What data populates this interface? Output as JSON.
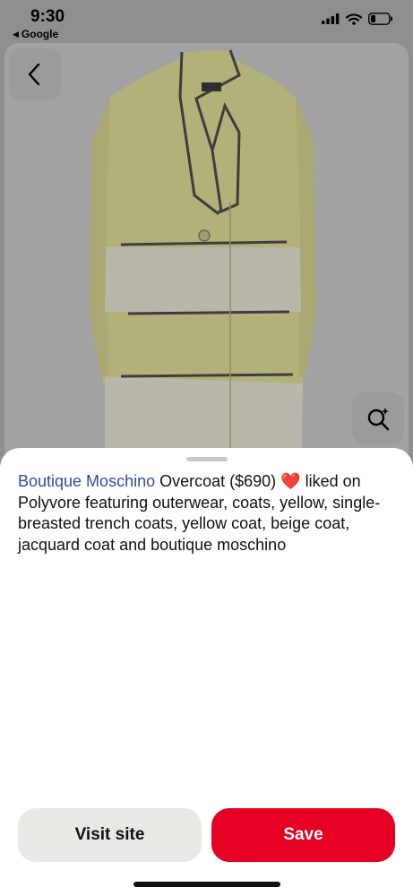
{
  "status_bar": {
    "time": "9:30",
    "back_app": "Google",
    "back_arrow": "◀",
    "icons": [
      "signal-icon",
      "wifi-icon",
      "battery-icon"
    ]
  },
  "image": {
    "subject_icon": "coat-image",
    "back_icon": "chevron-left-icon",
    "lens_icon": "visual-search-icon"
  },
  "pin": {
    "brand": "Boutique Moschino",
    "title_rest": " Overcoat ($690) ",
    "heart": "❤️",
    "description": " liked on Polyvore featuring outerwear, coats, yellow, single-breasted trench coats, yellow coat, beige coat, jacquard coat and boutique moschino"
  },
  "actions": {
    "visit_label": "Visit site",
    "save_label": "Save"
  },
  "colors": {
    "brand_link": "#2f4aa8",
    "save_button": "#e60023",
    "visit_button": "#e8e8e4"
  }
}
